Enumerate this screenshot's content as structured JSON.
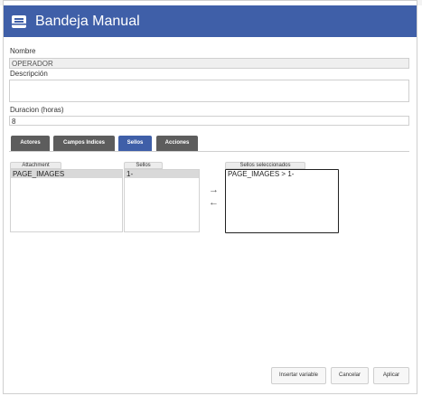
{
  "header": {
    "title": "Bandeja Manual",
    "icon": "tray-icon"
  },
  "form": {
    "nombre_label": "Nombre",
    "nombre_value": "OPERADOR",
    "descripcion_label": "Descripción",
    "descripcion_value": "",
    "duracion_label": "Duracion (horas)",
    "duracion_value": "8"
  },
  "tabs": [
    {
      "label": "Actores",
      "active": false
    },
    {
      "label": "Campos Indices",
      "active": false
    },
    {
      "label": "Sellos",
      "active": true
    },
    {
      "label": "Acciones",
      "active": false
    }
  ],
  "sellos": {
    "attachment_header": "Attachment",
    "attachment_items": [
      "PAGE_IMAGES"
    ],
    "sellos_header": "Sellos",
    "sellos_items": [
      "1-"
    ],
    "seleccionados_header": "Sellos seleccionados",
    "seleccionados_items": [
      "PAGE_IMAGES > 1-"
    ],
    "add_icon": "arrow-right-icon",
    "remove_icon": "arrow-left-icon"
  },
  "footer": {
    "insertar_label": "Insertar variable",
    "cancelar_label": "Cancelar",
    "aplicar_label": "Aplicar"
  },
  "colors": {
    "accent": "#3f5fa8",
    "tab_inactive": "#5d5d5d"
  }
}
